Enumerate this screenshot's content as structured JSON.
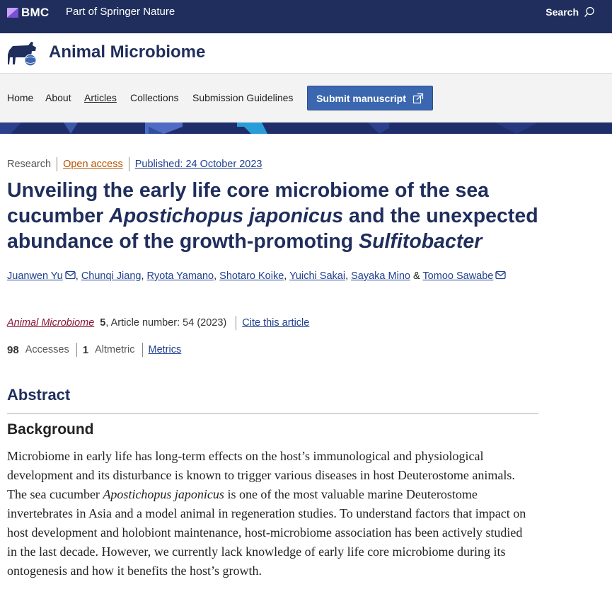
{
  "topbar": {
    "brand": "BMC",
    "tagline": "Part of Springer Nature",
    "search_label": "Search"
  },
  "journal": {
    "title": "Animal Microbiome"
  },
  "nav": {
    "items": [
      "Home",
      "About",
      "Articles",
      "Collections",
      "Submission Guidelines"
    ],
    "active": "Articles",
    "submit_label": "Submit manuscript"
  },
  "article": {
    "type": "Research",
    "open_access": "Open access",
    "published": "Published: 24 October 2023",
    "title_parts": {
      "p1": "Unveiling the early life core microbiome of the sea cucumber ",
      "i1": "Apostichopus japonicus",
      "p2": " and the unexpected abundance of the growth-promoting ",
      "i2": "Sulfitobacter"
    },
    "authors": [
      "Juanwen Yu",
      "Chunqi Jiang",
      "Ryota Yamano",
      "Shotaro Koike",
      "Yuichi Sakai",
      "Sayaka Mino",
      "Tomoo Sawabe"
    ],
    "author_sep": ", ",
    "author_and": " & ",
    "journal_name": "Animal Microbiome",
    "volume": "5",
    "article_number": ", Article number: 54 (2023)",
    "cite_label": "Cite this article",
    "accesses_count": "98",
    "accesses_label": "Accesses",
    "altmetric_count": "1",
    "altmetric_label": "Altmetric",
    "metrics_label": "Metrics"
  },
  "abstract": {
    "heading": "Abstract",
    "subheading": "Background",
    "p1": "Microbiome in early life has long-term effects on the host’s immunological and physiological development and its disturbance is known to trigger various diseases in host Deuterostome animals. The sea cucumber ",
    "species": "Apostichopus japonicus",
    "p2": " is one of the most valuable marine Deuterostome invertebrates in Asia and a model animal in regeneration studies. To understand factors that impact on host development and holobiont maintenance, host-microbiome association has been actively studied in the last decade. However, we currently lack knowledge of early life core microbiome during its ontogenesis and how it benefits the host’s growth."
  }
}
